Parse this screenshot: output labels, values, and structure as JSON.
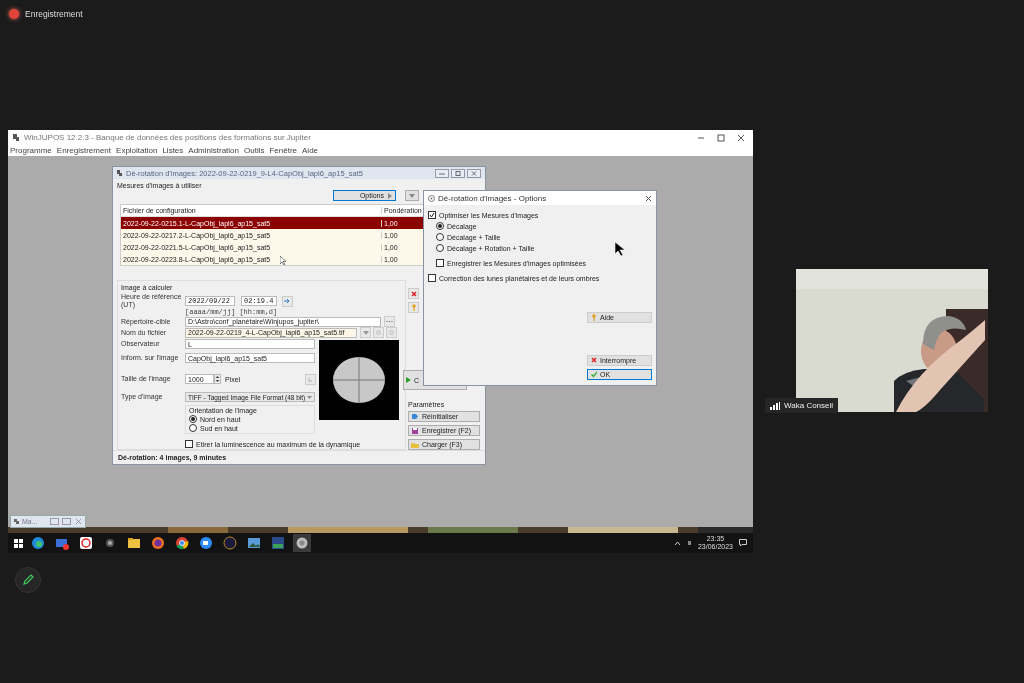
{
  "recording": {
    "label": "Enregistrement"
  },
  "shared_screen": {
    "window": {
      "title": "WinJUPOS 12.2.3 - Banque de données des positions des formations sur Jupiter"
    },
    "menu": [
      "Programme",
      "Enregistrement",
      "Exploitation",
      "Listes",
      "Administration",
      "Outils",
      "Fenêtre",
      "Aide"
    ],
    "derotation_dialog": {
      "title": "Dé-rotation d'images: 2022-09-22-0219_9-L4-CapObj_lapl6_ap15_sat5",
      "measures_label": "Mesures d'images à utiliser",
      "options_button": "Options",
      "table": {
        "columns": [
          "Fichier de configuration",
          "Pondération"
        ],
        "rows": [
          {
            "cells": [
              "2022-09-22-0215.1-L-CapObj_lapl6_ap15_sat5",
              "1,00"
            ],
            "selected": true
          },
          {
            "cells": [
              "2022-09-22-0217.2-L-CapObj_lapl6_ap15_sat5",
              "1,00"
            ],
            "selected": false
          },
          {
            "cells": [
              "2022-09-22-0221.5-L-CapObj_lapl6_ap15_sat5",
              "1,00"
            ],
            "selected": false
          },
          {
            "cells": [
              "2022-09-22-0223.8-L-CapObj_lapl6_ap15_sat5",
              "1,00"
            ],
            "selected": false
          }
        ]
      },
      "image_section": {
        "label": "Image à calculer",
        "ref_time_label": "Heure de référence (UT)",
        "date": "2022/09/22",
        "time": "02:19.4",
        "date_hint": "[aaaa/mm/jj]",
        "time_hint": "[hh:mm,d]",
        "target_dir": {
          "label": "Répertoire-cible",
          "value": "D:\\Astro\\conf_planétaire\\Winjupos_jupiter\\"
        },
        "file_name": {
          "label": "Nom du fichier",
          "value": "2022-09-22-0219_4-L-CapObj_lapl6_ap15_sat5.tif"
        },
        "observer": {
          "label": "Observateur",
          "value": "L"
        },
        "image_info": {
          "label": "Inform. sur l'image",
          "value": "CapObj_lapl6_ap15_sat5"
        },
        "size": {
          "label": "Taille de l'image",
          "value": "1000",
          "unit": "Pixel"
        },
        "type": {
          "label": "Type d'image",
          "value": "TIFF - Tagged Image File Format (48 bit)"
        },
        "orientation": {
          "label": "Orientation de l'image",
          "options": [
            {
              "label": "Nord en haut",
              "selected": true
            },
            {
              "label": "Sud en haut",
              "selected": false
            }
          ]
        },
        "stretch": {
          "label": "Etirer la luminescence au maximum de la dynamique",
          "checked": false
        }
      },
      "compute_button": "C",
      "parameters": {
        "label": "Paramètres",
        "buttons": [
          {
            "label": "Réinitialiser",
            "kind": "reset"
          },
          {
            "label": "Enregistrer (F2)",
            "kind": "save"
          },
          {
            "label": "Charger (F3)",
            "kind": "load"
          }
        ]
      },
      "status": "Dé-rotation: 4 images, 9 minutes"
    },
    "options_dialog": {
      "title": "Dé-rotation d'images - Options",
      "optimize": {
        "label": "Optimiser les Mesures d'images",
        "checked": true
      },
      "modes": [
        {
          "label": "Décalage",
          "selected": true
        },
        {
          "label": "Décalage + Taille",
          "selected": false
        },
        {
          "label": "Décalage + Rotation + Taille",
          "selected": false
        }
      ],
      "save_optimized": {
        "label": "Enregistrer les Mesures d'images optimisées",
        "checked": false
      },
      "moons_correction": {
        "label": "Correction des lunes planétaires et de leurs ombres",
        "checked": false
      },
      "buttons": [
        {
          "label": "Aide",
          "kind": "help"
        },
        {
          "label": "Interrompre",
          "kind": "cancel"
        },
        {
          "label": "OK",
          "kind": "ok"
        }
      ]
    },
    "minimized_window": {
      "title": "Ma..."
    },
    "taskbar": {
      "time": "23:35",
      "date": "23/06/2023"
    }
  },
  "participant": {
    "name": "Waka Conseil"
  }
}
